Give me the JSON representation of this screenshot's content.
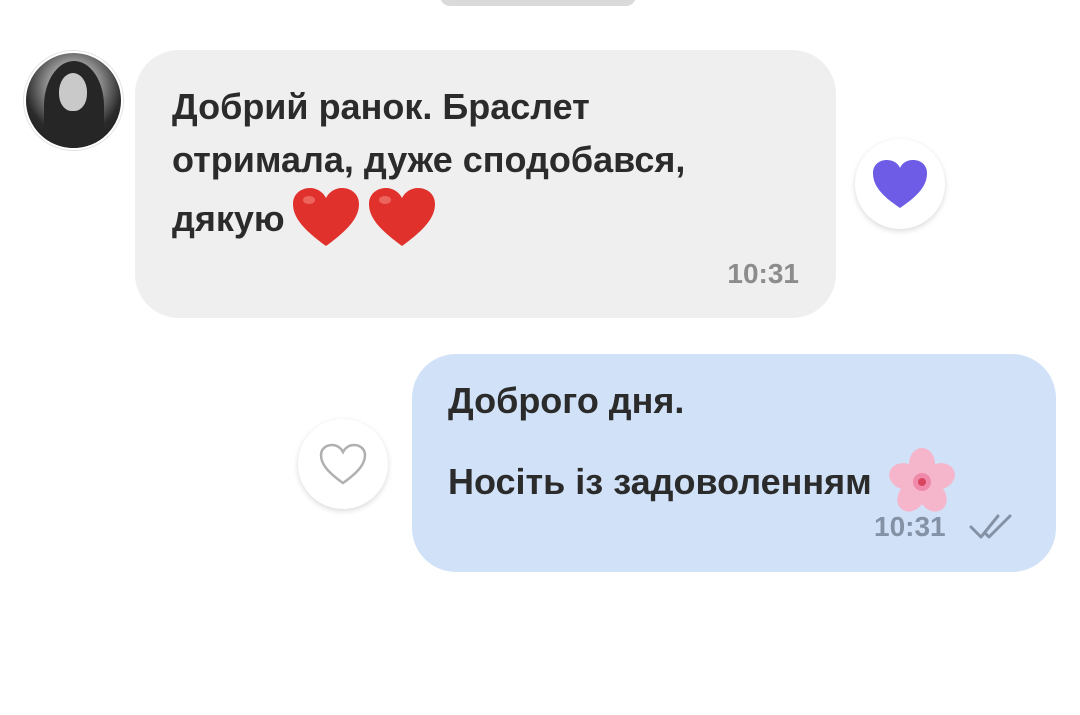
{
  "incoming_message": {
    "line1": "Добрий ранок. Браслет",
    "line2": "отримала, дуже сподобався,",
    "line3": "дякую",
    "emojis": [
      "red-heart-emoji",
      "red-heart-emoji"
    ],
    "time": "10:31",
    "reaction": "purple-heart-icon"
  },
  "outgoing_message": {
    "line1": "Доброго дня.",
    "line2": "Носіть із задоволенням",
    "emoji": "cherry-blossom-emoji",
    "time": "10:31",
    "status": "double-check-read"
  },
  "colors": {
    "incoming_bg": "#efefef",
    "outgoing_bg": "#d1e2f8",
    "reaction_heart": "#6f5ce6",
    "text": "#2b2b2b"
  }
}
